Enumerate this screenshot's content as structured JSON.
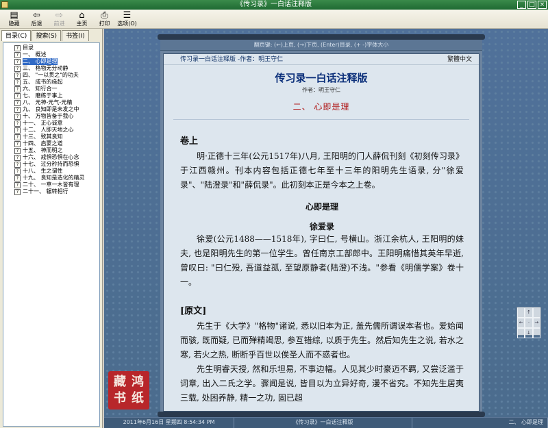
{
  "window": {
    "title": "《传习录》一白话注释版"
  },
  "toolbar": {
    "buttons": [
      {
        "label": "隐藏",
        "icon": "hide-icon"
      },
      {
        "label": "后退",
        "icon": "back-arrow-icon"
      },
      {
        "label": "前进",
        "icon": "forward-arrow-icon"
      },
      {
        "label": "主页",
        "icon": "home-icon"
      },
      {
        "label": "打印",
        "icon": "print-icon"
      },
      {
        "label": "选项(O)",
        "icon": "options-icon"
      }
    ]
  },
  "sidebar": {
    "tabs": [
      "目录(C)",
      "搜索(S)",
      "书签(I)"
    ],
    "items": [
      "目录",
      "一、 概述",
      "二、 心即是理",
      "三、 格物无分动静",
      "四、 \"一以贯之\"的功夫",
      "五、 成书的缘起",
      "六、 知行合一",
      "七、 磨练于事上",
      "八、 元神-元气-元精",
      "九、 良知即是未发之中",
      "十、 万物皆备于我心",
      "十一、 正心诚意",
      "十二、 人即天地之心",
      "十三、 致其良知",
      "十四、 启蒙之道",
      "十五、 神而明之",
      "十六、 戒惧恐惧在心念",
      "十七、 过分矜持而恐惧",
      "十八、 生之谓性",
      "十九、 良知是造化的精灵",
      "二十、 一草一木皆有理",
      "二十一、 辗转相行"
    ]
  },
  "reader": {
    "hint": "翻页键: (←)上页, (→)下页, (Enter)目录, (+ -)字体大小",
    "header_left": "传习录一白话注释版 -作者：明王守仁",
    "header_right": "繁體中文",
    "book_title": "传习录一白话注释版",
    "author": "作者：明王守仁",
    "chapter": "二、 心即是理",
    "section1": "卷上",
    "para1": "明·正德十三年(公元1517年)八月, 王阳明的门人薛侃刊刻《初刻传习录》于江西赣州。刊本内容包括正德七年至十三年的阳明先生语录, 分\"徐爱录\"、\"陆澄录\"和\"薛侃录\"。此初刻本正是今本之上卷。",
    "subhead1": "心即是理",
    "subhead2": "徐爱录",
    "para2": "徐爱(公元1488——1518年), 字曰仁, 号横山。浙江余杭人, 王阳明的妹夫, 也是阳明先生的第一位学生。曾任南京工部郎中。王阳明痛惜其英年早逝, 曾叹曰: \"曰仁殁, 吾道益孤, 至望原静者(陆澄)不浅。\"参看《明儒学案》卷十一。",
    "section2": "[原文]",
    "para3": "先生于《大学》\"格物\"诸说, 悉以旧本为正, 盖先儒所谓误本者也。爱始闻而骇, 既而疑, 已而殚精竭思, 参互错综, 以质于先生。然后知先生之说, 若水之寒, 若火之热, 断断乎百世以俟圣人而不惑者也。",
    "para4": "先生明睿天授, 然和乐坦易, 不事边幅。人见其少时豪迈不羁, 又尝泛滥于词章, 出入二氏之学。骤闻是说, 皆目以为立异好奇, 漫不省究。不知先生居夷三载, 处困养静, 精一之功, 固已超",
    "nav_pad": [
      "",
      "↑",
      "",
      "←",
      "·",
      "→",
      "",
      "↓",
      ""
    ],
    "seal": [
      "藏",
      "鸿",
      "书",
      "纸"
    ]
  },
  "status": {
    "datetime": "2011年6月16日 星期四 8:54:34 PM",
    "book": "《传习录》一白话注释版",
    "chapter": "二、 心即是理"
  }
}
